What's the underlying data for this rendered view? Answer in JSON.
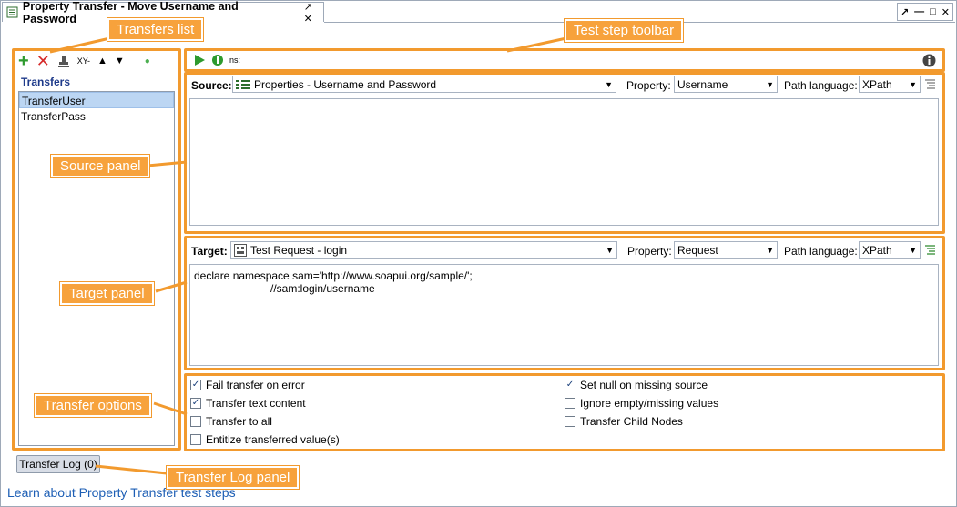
{
  "window": {
    "title": "Property Transfer - Move Username and Password",
    "title_controls": "↗ ✕",
    "controls": [
      "↗",
      "—",
      "□",
      "✕"
    ]
  },
  "left_panel": {
    "toolbar_icons": [
      "add-icon",
      "delete-icon",
      "stamp-icon",
      "xy-icon",
      "move-up-icon",
      "move-down-icon",
      "dot-icon"
    ],
    "xy_label": "XY-",
    "header": "Transfers",
    "transfers": [
      {
        "name": "TransferUser",
        "selected": true
      },
      {
        "name": "TransferPass",
        "selected": false
      }
    ]
  },
  "step_toolbar": {
    "ns_label": "ns:"
  },
  "source": {
    "label": "Source:",
    "value": "Properties - Username and Password",
    "property_label": "Property:",
    "property_value": "Username",
    "path_language_label": "Path language:",
    "path_language_value": "XPath",
    "expression": ""
  },
  "target": {
    "label": "Target:",
    "value": "Test Request - login",
    "property_label": "Property:",
    "property_value": "Request",
    "path_language_label": "Path language:",
    "path_language_value": "XPath",
    "expression_line1": "declare namespace sam='http://www.soapui.org/sample/';",
    "expression_line2": "//sam:login/username"
  },
  "options": {
    "left": [
      {
        "label": "Fail transfer on error",
        "checked": true
      },
      {
        "label": "Transfer text content",
        "checked": true
      },
      {
        "label": "Transfer to all",
        "checked": false
      },
      {
        "label": "Entitize transferred value(s)",
        "checked": false
      }
    ],
    "right": [
      {
        "label": "Set null on missing source",
        "checked": true
      },
      {
        "label": "Ignore empty/missing values",
        "checked": false
      },
      {
        "label": "Transfer Child Nodes",
        "checked": false
      }
    ]
  },
  "log_tab": "Transfer Log (0)",
  "learn_link": "Learn about Property Transfer test steps",
  "callouts": {
    "transfers_list": "Transfers list",
    "test_step_toolbar": "Test step toolbar",
    "source_panel": "Source panel",
    "target_panel": "Target panel",
    "transfer_options": "Transfer options",
    "transfer_log_panel": "Transfer Log panel"
  },
  "colors": {
    "highlight": "#f29a2e",
    "callout_bg": "#f7a23c",
    "link": "#1e5fb5",
    "selected_row": "#bcd6f3"
  }
}
